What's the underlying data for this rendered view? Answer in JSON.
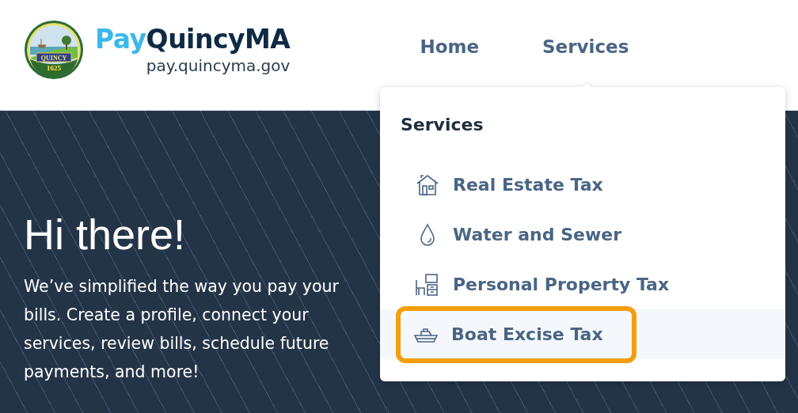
{
  "header": {
    "logo": {
      "banner": "QUINCY",
      "year": "1625"
    },
    "brand": {
      "first": "Pay",
      "rest": "QuincyMA"
    },
    "domain": "pay.quincyma.gov",
    "nav": [
      {
        "label": "Home",
        "expanded": false
      },
      {
        "label": "Services",
        "expanded": true
      }
    ]
  },
  "hero": {
    "title": "Hi there!",
    "text": "We’ve simplified the way you pay your bills. Create a profile, connect your services, review bills, schedule future payments, and more!"
  },
  "dropdown": {
    "heading": "Services",
    "items": [
      {
        "kind": "house",
        "label": "Real Estate Tax",
        "selected": false
      },
      {
        "kind": "drop",
        "label": "Water and Sewer",
        "selected": false
      },
      {
        "kind": "office",
        "label": "Personal Property Tax",
        "selected": false
      },
      {
        "kind": "boat",
        "label": "Boat Excise Tax",
        "selected": true
      }
    ]
  }
}
